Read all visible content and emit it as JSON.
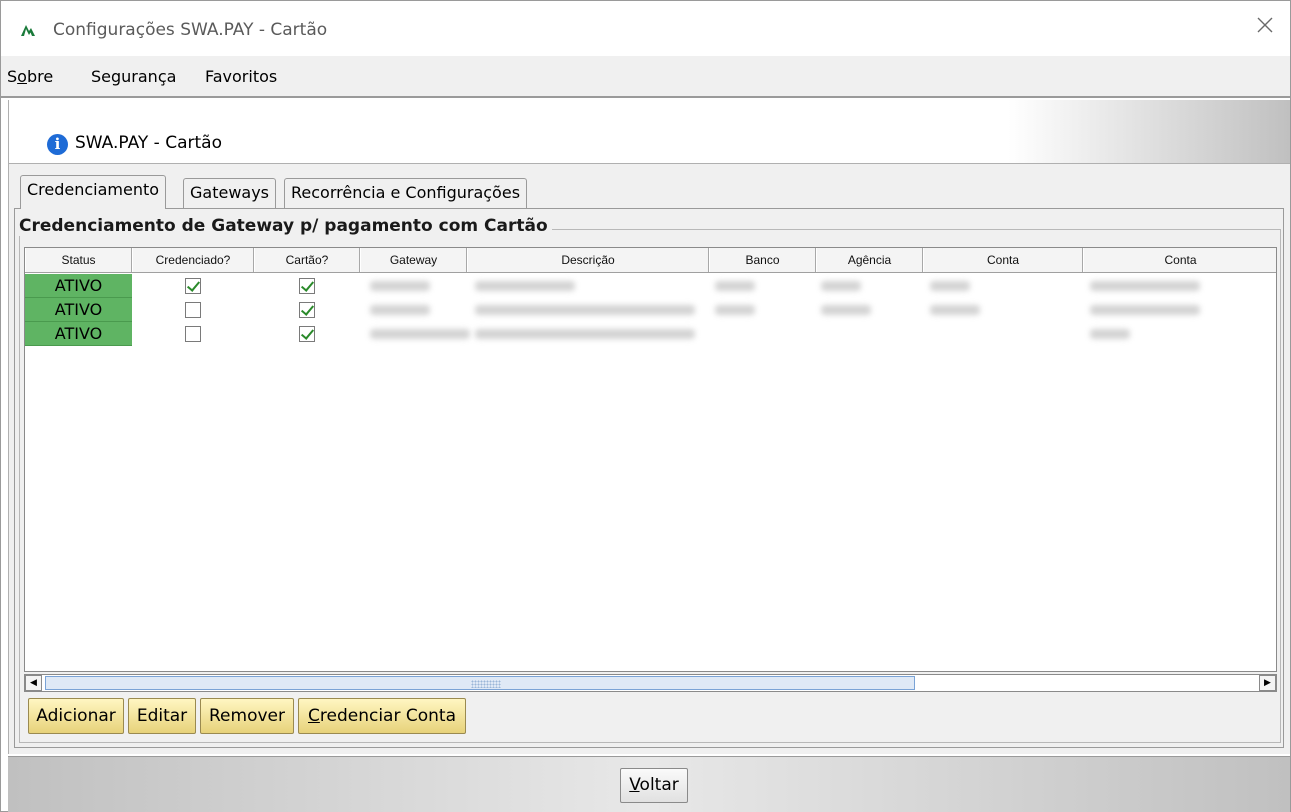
{
  "window": {
    "title": "Configurações SWA.PAY - Cartão",
    "close_label": "✕"
  },
  "menu": {
    "items": [
      {
        "label_pre": "S",
        "label_u": "o",
        "label_post": "bre"
      },
      {
        "label": "Segurança"
      },
      {
        "label": "Favoritos"
      }
    ]
  },
  "header": {
    "title": "SWA.PAY - Cartão",
    "info_glyph": "i"
  },
  "tabs": [
    {
      "label": "Credenciamento",
      "active": true
    },
    {
      "label": "Gateways",
      "active": false
    },
    {
      "label": "Recorrência e Configurações",
      "active": false
    }
  ],
  "group": {
    "title": "Credenciamento de Gateway p/ pagamento com Cartão"
  },
  "table": {
    "columns": [
      "Status",
      "Credenciado?",
      "Cartão?",
      "Gateway",
      "Descrição",
      "Banco",
      "Agência",
      "Conta",
      "Conta"
    ],
    "rows": [
      {
        "status": "ATIVO",
        "credenciado": true,
        "cartao": true
      },
      {
        "status": "ATIVO",
        "credenciado": false,
        "cartao": true
      },
      {
        "status": "ATIVO",
        "credenciado": false,
        "cartao": true
      }
    ],
    "status_color": "#5fb463"
  },
  "buttons": {
    "adicionar": "Adicionar",
    "editar": "Editar",
    "remover": "Remover",
    "credenciar_u": "C",
    "credenciar_rest": "redenciar Conta"
  },
  "footer": {
    "voltar_u": "V",
    "voltar_rest": "oltar"
  },
  "colors": {
    "button_gradient_top": "#fff6c2",
    "button_gradient_bottom": "#e7d27a",
    "info_icon": "#1e6bd6"
  }
}
